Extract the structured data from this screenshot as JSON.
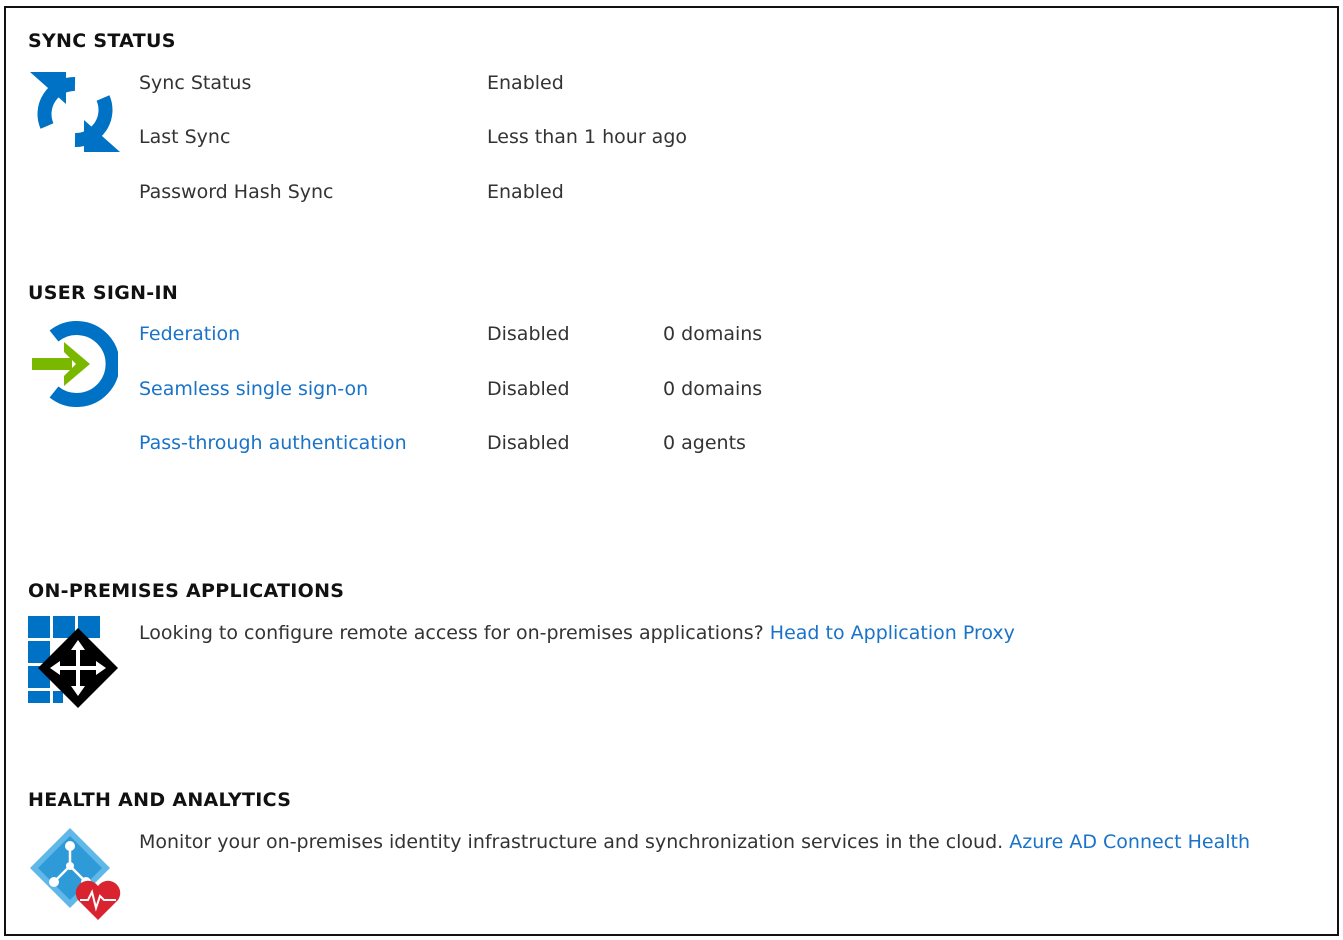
{
  "colors": {
    "link": "#1a73c8",
    "icon_blue": "#0072c6",
    "arrow_green": "#7ab800",
    "heart_red": "#e81123"
  },
  "sync_status": {
    "title": "SYNC STATUS",
    "icon": "sync-icon",
    "rows": [
      {
        "label": "Sync Status",
        "value": "Enabled"
      },
      {
        "label": "Last Sync",
        "value": "Less than 1 hour ago"
      },
      {
        "label": "Password Hash Sync",
        "value": "Enabled"
      }
    ]
  },
  "user_sign_in": {
    "title": "USER SIGN-IN",
    "icon": "sign-in-icon",
    "rows": [
      {
        "label": "Federation",
        "value": "Disabled",
        "count": "0 domains"
      },
      {
        "label": "Seamless single sign-on",
        "value": "Disabled",
        "count": "0 domains"
      },
      {
        "label": "Pass-through authentication",
        "value": "Disabled",
        "count": "0 agents"
      }
    ]
  },
  "on_premises": {
    "title": "ON-PREMISES APPLICATIONS",
    "icon": "application-proxy-icon",
    "text": "Looking to configure remote access for on-premises applications?",
    "link": "Head to Application Proxy"
  },
  "health": {
    "title": "HEALTH AND ANALYTICS",
    "icon": "connect-health-icon",
    "text": "Monitor your on-premises identity infrastructure and synchronization services in the cloud.",
    "link": "Azure AD Connect Health"
  }
}
